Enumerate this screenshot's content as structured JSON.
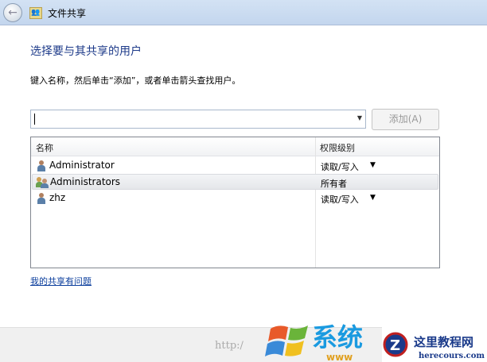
{
  "window": {
    "title": "文件共享"
  },
  "heading": "选择要与其共享的用户",
  "instruction": "键入名称，然后单击“添加”，或者单击箭头查找用户。",
  "name_input": {
    "value": ""
  },
  "add_button": "添加(A)",
  "list": {
    "columns": [
      "名称",
      "权限级别"
    ],
    "rows": [
      {
        "name": "Administrator",
        "icon": "user-icon",
        "permission": "读取/写入",
        "has_dropdown": true,
        "selected": false
      },
      {
        "name": "Administrators",
        "icon": "group-icon",
        "permission": "所有者",
        "has_dropdown": false,
        "selected": true
      },
      {
        "name": "zhz",
        "icon": "user-icon",
        "permission": "读取/写入",
        "has_dropdown": true,
        "selected": false
      }
    ]
  },
  "help_link": "我的共享有问题",
  "watermark": {
    "url": "http:/",
    "site1": "系统之家",
    "site1_url": "www",
    "site2": "这里教程网",
    "site2_url": "herecours.com"
  }
}
